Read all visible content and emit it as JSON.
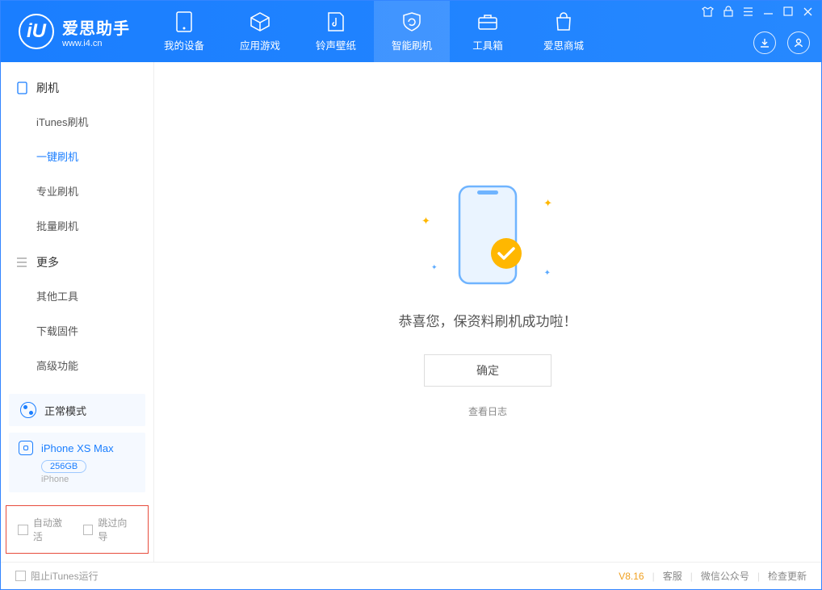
{
  "app": {
    "name": "爱思助手",
    "url": "www.i4.cn"
  },
  "tabs": [
    {
      "label": "我的设备"
    },
    {
      "label": "应用游戏"
    },
    {
      "label": "铃声壁纸"
    },
    {
      "label": "智能刷机"
    },
    {
      "label": "工具箱"
    },
    {
      "label": "爱思商城"
    }
  ],
  "sidebar": {
    "group1": {
      "title": "刷机"
    },
    "items1": [
      {
        "label": "iTunes刷机"
      },
      {
        "label": "一键刷机"
      },
      {
        "label": "专业刷机"
      },
      {
        "label": "批量刷机"
      }
    ],
    "group2": {
      "title": "更多"
    },
    "items2": [
      {
        "label": "其他工具"
      },
      {
        "label": "下载固件"
      },
      {
        "label": "高级功能"
      }
    ]
  },
  "mode": {
    "label": "正常模式"
  },
  "device": {
    "name": "iPhone XS Max",
    "capacity": "256GB",
    "type": "iPhone"
  },
  "options": {
    "auto_activate": "自动激活",
    "skip_guide": "跳过向导"
  },
  "main": {
    "success_message": "恭喜您，保资料刷机成功啦！",
    "confirm_button": "确定",
    "view_log": "查看日志"
  },
  "footer": {
    "block_itunes": "阻止iTunes运行",
    "version": "V8.16",
    "support": "客服",
    "wechat": "微信公众号",
    "check_update": "检查更新"
  }
}
